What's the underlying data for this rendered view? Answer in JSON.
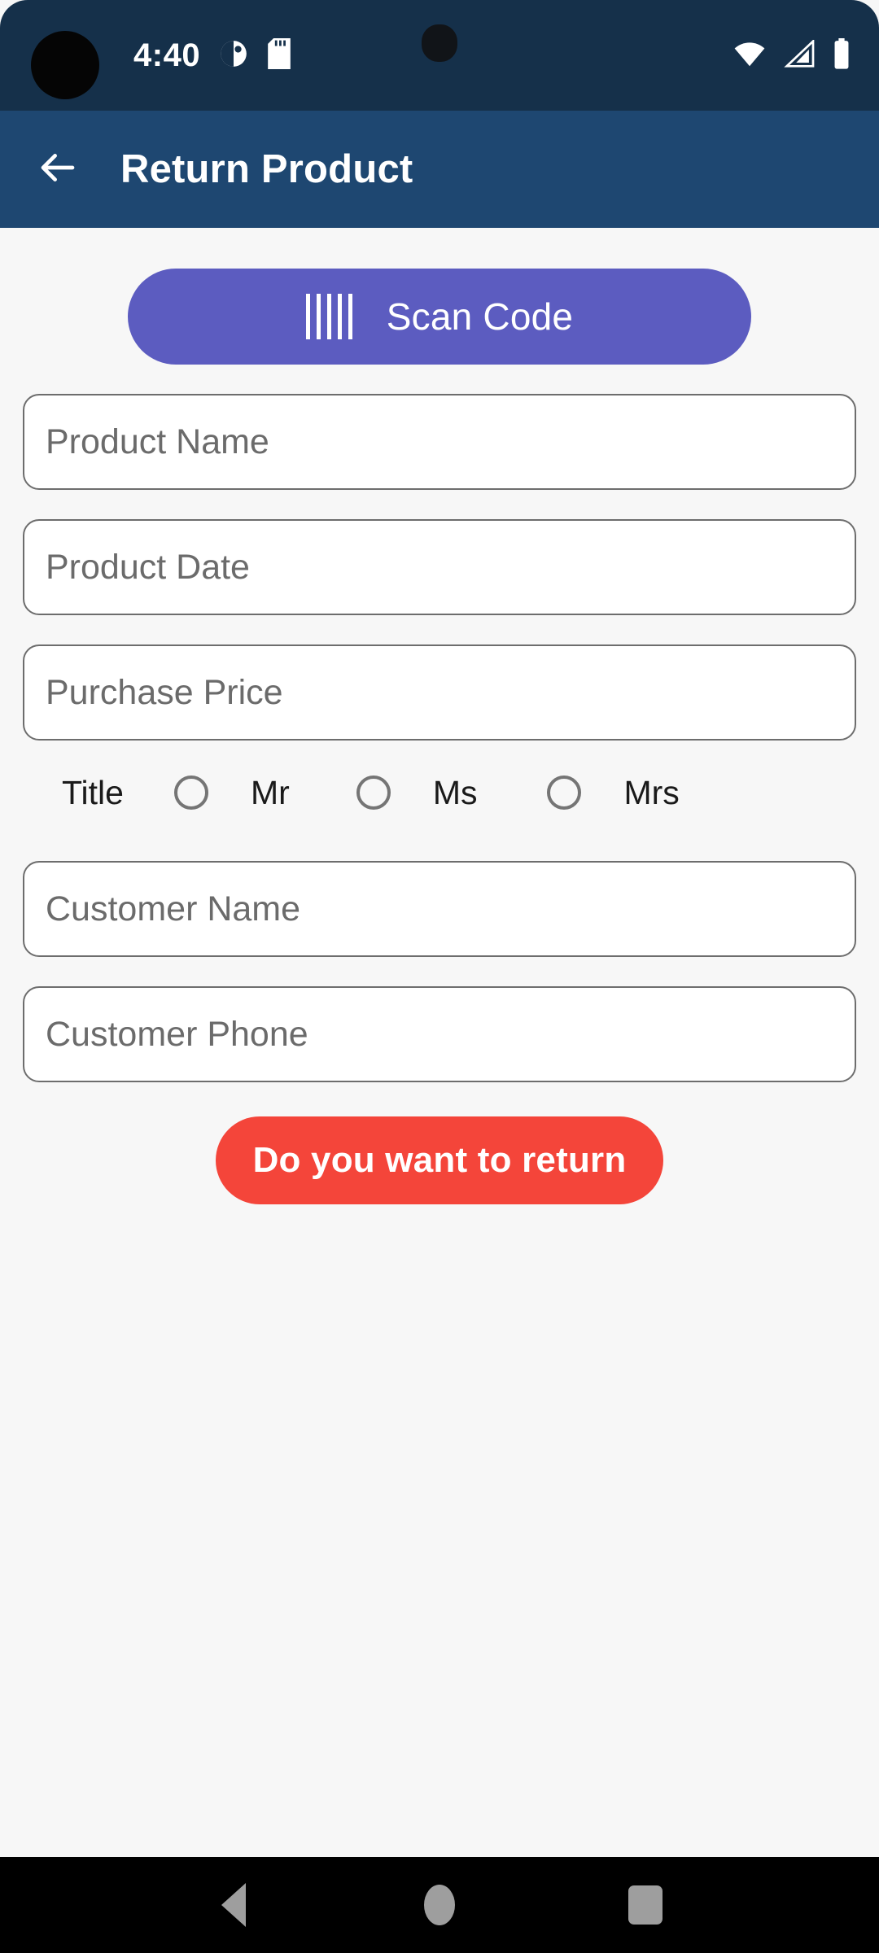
{
  "status_bar": {
    "time": "4:40",
    "icons": {
      "notification_left_1": "half-circle-icon",
      "notification_left_2": "sd-card-icon",
      "notification_center": "app-notification-icon",
      "wifi": "wifi-icon",
      "signal": "cellular-signal-icon",
      "battery": "battery-full-icon"
    },
    "camera": "front-camera-cutout"
  },
  "app_bar": {
    "back_icon": "arrow-left-icon",
    "title": "Return Product"
  },
  "form": {
    "scan_button": {
      "label": "Scan Code",
      "icon": "barcode-icon",
      "color": "#5c5cc0"
    },
    "fields": [
      {
        "name": "product-name",
        "placeholder": "Product Name",
        "value": ""
      },
      {
        "name": "product-date",
        "placeholder": "Product Date",
        "value": ""
      },
      {
        "name": "purchase-price",
        "placeholder": "Purchase Price",
        "value": ""
      }
    ],
    "title_row": {
      "label": "Title",
      "options": [
        {
          "label": "Mr",
          "selected": false
        },
        {
          "label": "Ms",
          "selected": false
        },
        {
          "label": "Mrs",
          "selected": false
        }
      ]
    },
    "customer_fields": [
      {
        "name": "customer-name",
        "placeholder": "Customer Name",
        "value": ""
      },
      {
        "name": "customer-phone",
        "placeholder": "Customer Phone",
        "value": ""
      }
    ],
    "submit_button": {
      "label": "Do you want to return",
      "color": "#f4453a"
    }
  },
  "nav_bar": {
    "back": "triangle-back-icon",
    "home": "circle-home-icon",
    "recents": "square-recents-icon"
  },
  "colors": {
    "status_bar": "#15304a",
    "app_bar": "#1e4771",
    "background": "#f7f7f7",
    "accent_purple": "#5c5cc0",
    "accent_red": "#f4453a",
    "field_border": "#6d6d6d"
  }
}
